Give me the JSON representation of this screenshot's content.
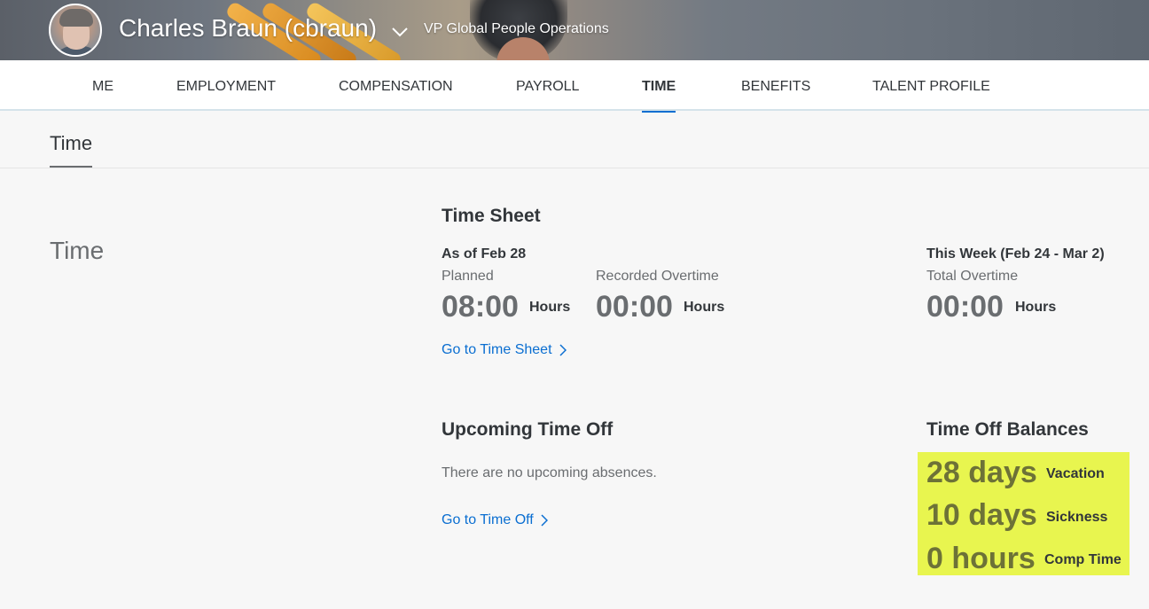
{
  "header": {
    "user_name": "Charles Braun (cbraun)",
    "user_title": "VP Global People Operations"
  },
  "nav": {
    "items": [
      {
        "label": "ME"
      },
      {
        "label": "EMPLOYMENT"
      },
      {
        "label": "COMPENSATION"
      },
      {
        "label": "PAYROLL"
      },
      {
        "label": "TIME"
      },
      {
        "label": "BENEFITS"
      },
      {
        "label": "TALENT PROFILE"
      }
    ],
    "active": "TIME"
  },
  "section_tab": "Time",
  "side_heading": "Time",
  "time_sheet": {
    "title": "Time Sheet",
    "as_of": "As of Feb 28",
    "planned_label": "Planned",
    "planned_value": "08:00",
    "planned_unit": "Hours",
    "recorded_label": "Recorded Overtime",
    "recorded_value": "00:00",
    "recorded_unit": "Hours",
    "week_label": "This Week (Feb 24 - Mar 2)",
    "total_label": "Total Overtime",
    "total_value": "00:00",
    "total_unit": "Hours",
    "link": "Go to Time Sheet"
  },
  "time_off": {
    "title": "Upcoming Time Off",
    "empty": "There are no upcoming absences.",
    "link": "Go to Time Off"
  },
  "balances": {
    "title": "Time Off Balances",
    "highlight_color": "#e8f54f",
    "items": [
      {
        "value": "28 days",
        "label": "Vacation"
      },
      {
        "value": "10 days",
        "label": "Sickness"
      },
      {
        "value": "0 hours",
        "label": "Comp Time"
      }
    ]
  }
}
